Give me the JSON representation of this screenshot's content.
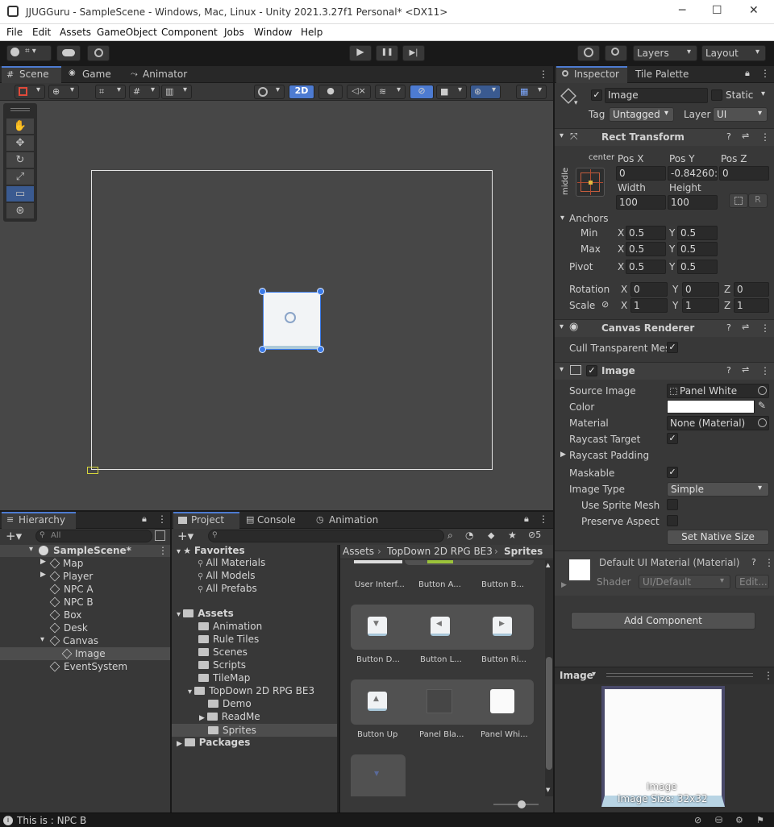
{
  "window": {
    "title": "JJUGGuru - SampleScene - Windows, Mac, Linux - Unity 2021.3.27f1 Personal* <DX11>",
    "minimize": "─",
    "maximize": "☐",
    "close": "✕"
  },
  "menu": [
    "File",
    "Edit",
    "Assets",
    "GameObject",
    "Component",
    "Jobs",
    "Window",
    "Help"
  ],
  "toolbar": {
    "play": "▶",
    "pause": "❚❚",
    "step": "▶|",
    "layers": "Layers",
    "layout": "Layout"
  },
  "scene_tabs": {
    "scene": "Scene",
    "game": "Game",
    "animator": "Animator"
  },
  "scene_toolbar": {
    "mode_2d": "2D"
  },
  "inspector": {
    "tab": "Inspector",
    "tab2": "Tile Palette",
    "object": {
      "name": "Image",
      "static_label": "Static",
      "tag_label": "Tag",
      "tag_value": "Untagged",
      "layer_label": "Layer",
      "layer_value": "UI"
    },
    "rect_transform": {
      "title": "Rect Transform",
      "anchor_h": "center",
      "anchor_v": "middle",
      "posx_label": "Pos X",
      "posy_label": "Pos Y",
      "posz_label": "Pos Z",
      "posx": "0",
      "posy": "-0.84260:",
      "posz": "0",
      "width_label": "Width",
      "height_label": "Height",
      "width": "100",
      "height": "100",
      "r_button": "R",
      "anchors_label": "Anchors",
      "min_label": "Min",
      "max_label": "Max",
      "min_x": "0.5",
      "min_y": "0.5",
      "max_x": "0.5",
      "max_y": "0.5",
      "pivot_label": "Pivot",
      "pivot_x": "0.5",
      "pivot_y": "0.5",
      "rotation_label": "Rotation",
      "rot_x": "0",
      "rot_y": "0",
      "rot_z": "0",
      "scale_label": "Scale",
      "scale_x": "1",
      "scale_y": "1",
      "scale_z": "1",
      "x": "X",
      "y": "Y",
      "z": "Z"
    },
    "canvas_renderer": {
      "title": "Canvas Renderer",
      "cull_label": "Cull Transparent Mes"
    },
    "image": {
      "title": "Image",
      "source_label": "Source Image",
      "source_value": "Panel White",
      "color_label": "Color",
      "material_label": "Material",
      "material_value": "None (Material)",
      "raycast_target_label": "Raycast Target",
      "raycast_padding_label": "Raycast Padding",
      "maskable_label": "Maskable",
      "image_type_label": "Image Type",
      "image_type_value": "Simple",
      "use_sprite_mesh_label": "Use Sprite Mesh",
      "preserve_aspect_label": "Preserve Aspect",
      "set_native_size": "Set Native Size"
    },
    "material": {
      "title": "Default UI Material (Material)",
      "shader_label": "Shader",
      "shader_value": "UI/Default",
      "edit_button": "Edit..."
    },
    "add_component": "Add Component",
    "preview": {
      "title": "Image",
      "caption_name": "Image",
      "caption_size": "Image Size: 32x32"
    }
  },
  "hierarchy": {
    "tab": "Hierarchy",
    "search_placeholder": "All",
    "scene": "SampleScene*",
    "items": [
      "Map",
      "Player",
      "NPC A",
      "NPC B",
      "Box",
      "Desk",
      "Canvas",
      "Image",
      "EventSystem"
    ]
  },
  "project": {
    "tabs": {
      "project": "Project",
      "console": "Console",
      "animation": "Animation"
    },
    "hidden_count": "5",
    "favorites_label": "Favorites",
    "favorites": [
      "All Materials",
      "All Models",
      "All Prefabs"
    ],
    "assets_label": "Assets",
    "assets": [
      "Animation",
      "Rule Tiles",
      "Scenes",
      "Scripts",
      "TileMap",
      "TopDown 2D RPG BE3"
    ],
    "topdown_children": [
      "Demo",
      "ReadMe",
      "Sprites"
    ],
    "packages_label": "Packages",
    "breadcrumb": [
      "Assets",
      "TopDown 2D RPG BE3",
      "Sprites"
    ],
    "grid_row0": [
      "User Interf...",
      "Button A...",
      "Button B..."
    ],
    "grid_row1": [
      "Button D...",
      "Button L...",
      "Button Ri..."
    ],
    "grid_row2": [
      "Button Up",
      "Panel Bla...",
      "Panel Whi..."
    ]
  },
  "status_bar": {
    "message": "This is : NPC B"
  },
  "colors": {
    "accent": "#4d7bd1",
    "handle": "#3b7be8",
    "panel": "#383838",
    "scene_bg": "#474747"
  }
}
